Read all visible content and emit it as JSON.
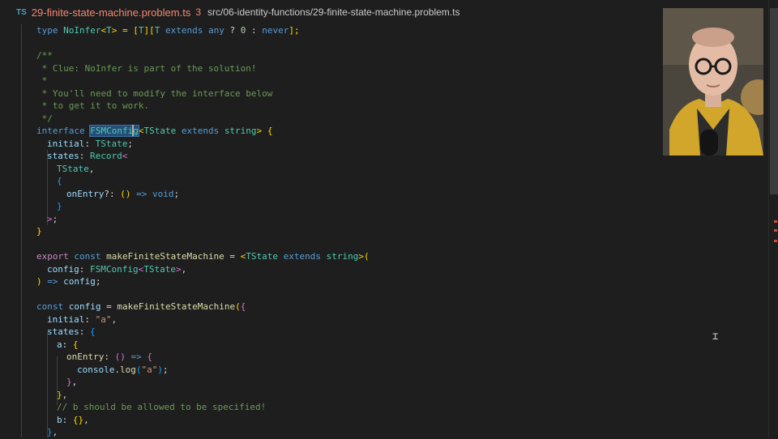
{
  "tab": {
    "lang_badge": "TS",
    "file_name": "29-finite-state-machine.problem.ts",
    "problem_count": "3",
    "path": "src/06-identity-functions/29-finite-state-machine.problem.ts"
  },
  "code": {
    "l1": {
      "t1": "type ",
      "t2": "NoInfer",
      "t3": "<",
      "t4": "T",
      "t5": "> = ",
      "t6": "[",
      "t7": "T",
      "t8": "]",
      "t9": "[",
      "t10": "T ",
      "t11": "extends ",
      "t12": "any",
      "t13": " ? ",
      "t14": "0",
      "t15": " : ",
      "t16": "never",
      "t17": "];"
    },
    "l3": "/**",
    "l4": " * Clue: NoInfer is part of the solution!",
    "l5": " *",
    "l6": " * You'll need to modify the interface below",
    "l7": " * to get it to work.",
    "l8": " */",
    "l9": {
      "t1": "interface ",
      "t2": "FSMConfig",
      "t3": "<",
      "t4": "TState ",
      "t5": "extends ",
      "t6": "string",
      "t7": "> ",
      "t8": "{"
    },
    "l10": {
      "t1": "initial",
      "t2": ": ",
      "t3": "TState",
      "t4": ";"
    },
    "l11": {
      "t1": "states",
      "t2": ": ",
      "t3": "Record",
      "t4": "<"
    },
    "l12": {
      "t1": "TState",
      "t2": ","
    },
    "l13": "{",
    "l14": {
      "t1": "onEntry",
      "t2": "?: ",
      "t3": "()",
      "t4": " => ",
      "t5": "void",
      "t6": ";"
    },
    "l15": "}",
    "l16": {
      "t1": ">",
      "t2": ";"
    },
    "l17": "}",
    "l19": {
      "t1": "export ",
      "t2": "const ",
      "t3": "makeFiniteStateMachine",
      "t4": " = ",
      "t5": "<",
      "t6": "TState ",
      "t7": "extends ",
      "t8": "string",
      "t9": ">",
      "t10": "("
    },
    "l20": {
      "t1": "config",
      "t2": ": ",
      "t3": "FSMConfig",
      "t4": "<",
      "t5": "TState",
      "t6": ">",
      "t7": ","
    },
    "l21": {
      "t1": ")",
      "t2": " => ",
      "t3": "config",
      "t4": ";"
    },
    "l23": {
      "t1": "const ",
      "t2": "config",
      "t3": " = ",
      "t4": "makeFiniteStateMachine",
      "t5": "(",
      "t6": "{"
    },
    "l24": {
      "t1": "initial",
      "t2": ": ",
      "t3": "\"a\"",
      "t4": ","
    },
    "l25": {
      "t1": "states",
      "t2": ": ",
      "t3": "{"
    },
    "l26": {
      "t1": "a",
      "t2": ": ",
      "t3": "{"
    },
    "l27": {
      "t1": "onEntry",
      "t2": ": ",
      "t3": "()",
      "t4": " => ",
      "t5": "{"
    },
    "l28": {
      "t1": "console",
      "t2": ".",
      "t3": "log",
      "t4": "(",
      "t5": "\"a\"",
      "t6": ")",
      "t7": ";"
    },
    "l29": {
      "t1": "}",
      "t2": ","
    },
    "l30": {
      "t1": "}",
      "t2": ","
    },
    "l31": "// b should be allowed to be specified!",
    "l32": {
      "t1": "b",
      "t2": ": ",
      "t3": "{}",
      "t4": ","
    },
    "l33": {
      "t1": "}",
      "t2": ","
    }
  },
  "colors": {
    "background": "#1e1e1e",
    "keyword": "#569cd6",
    "type": "#4ec9b0",
    "function": "#dcdcaa",
    "property": "#9cdcfe",
    "comment": "#6a9955",
    "string": "#ce9178",
    "error_file": "#f48771",
    "selection": "#264f78"
  }
}
